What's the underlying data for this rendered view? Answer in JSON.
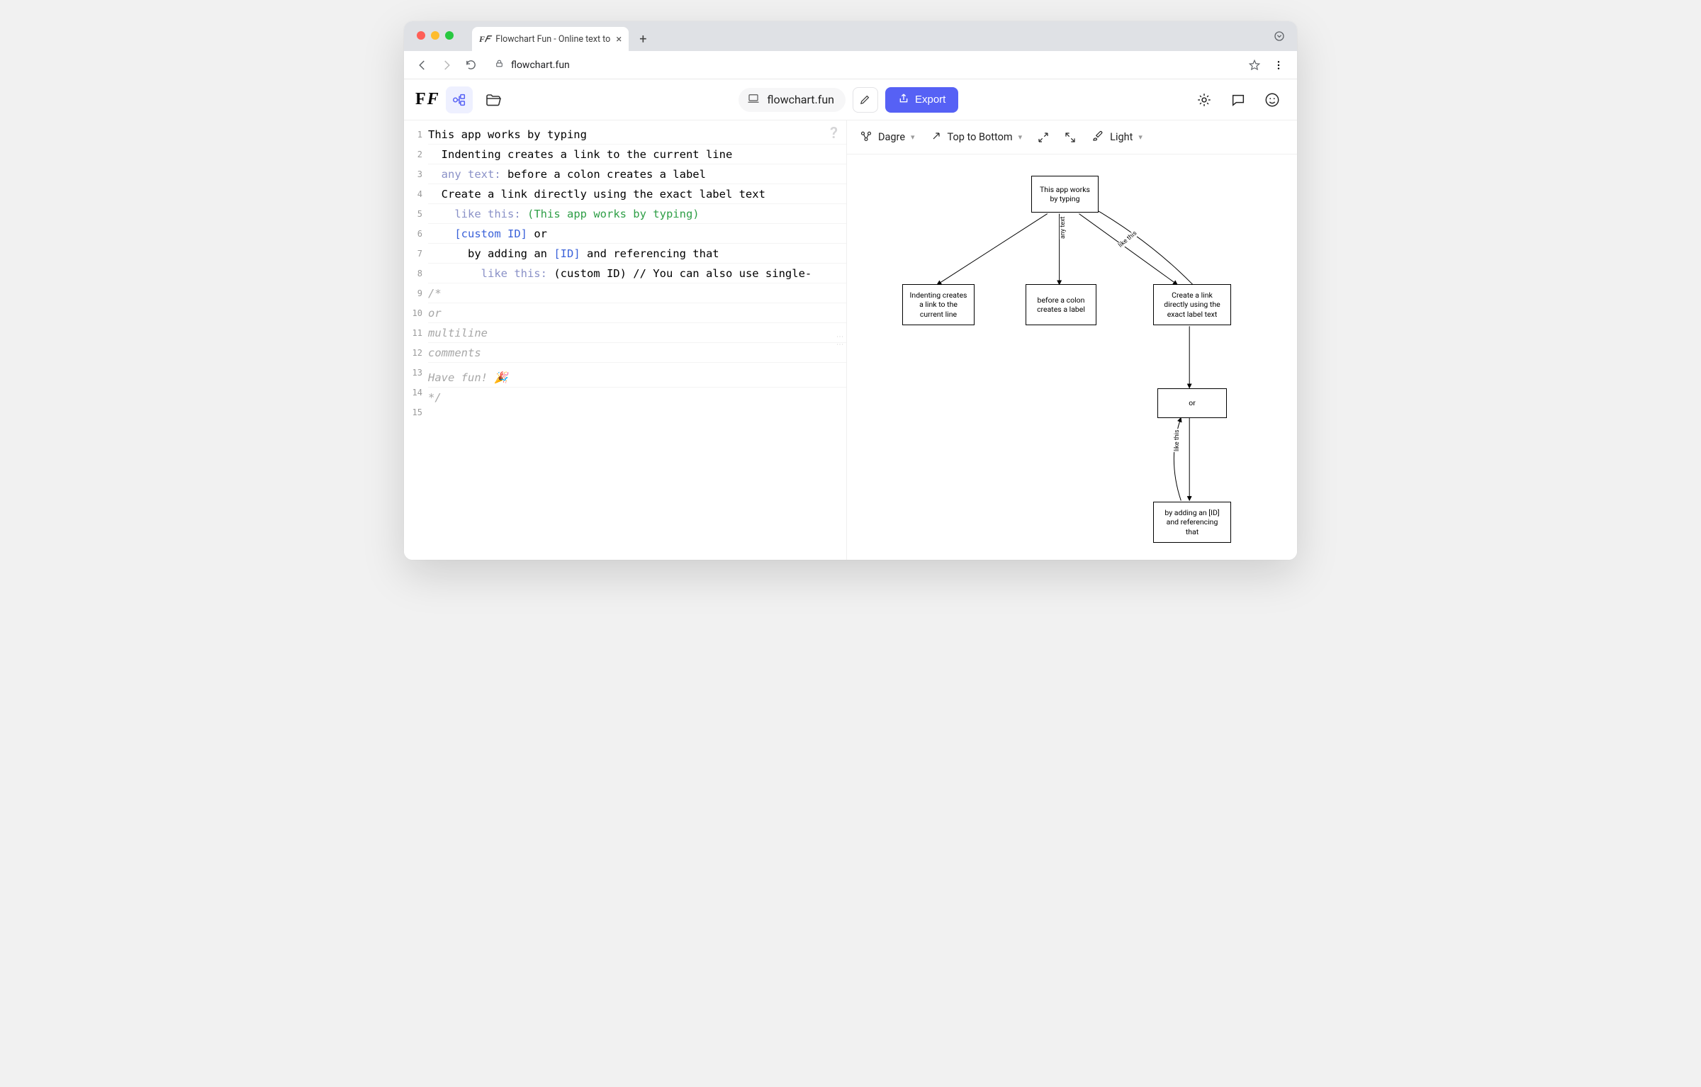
{
  "browser": {
    "tab_title": "Flowchart Fun - Online text to",
    "url": "flowchart.fun"
  },
  "header": {
    "doc_name": "flowchart.fun",
    "export_label": "Export"
  },
  "graph_toolbar": {
    "layout": "Dagre",
    "direction": "Top to Bottom",
    "theme": "Light"
  },
  "editor": {
    "lines": [
      {
        "n": 1,
        "indent": 0,
        "segs": [
          {
            "t": "This app works by typing"
          }
        ]
      },
      {
        "n": 2,
        "indent": 1,
        "segs": [
          {
            "t": "Indenting creates a link to the current line"
          }
        ]
      },
      {
        "n": 3,
        "indent": 1,
        "segs": [
          {
            "t": "any text:",
            "c": "tok-label"
          },
          {
            "t": " before a colon creates a label"
          }
        ]
      },
      {
        "n": 4,
        "indent": 1,
        "segs": [
          {
            "t": "Create a link directly using the exact label text"
          }
        ]
      },
      {
        "n": 5,
        "indent": 2,
        "segs": [
          {
            "t": "like this:",
            "c": "tok-label"
          },
          {
            "t": " "
          },
          {
            "t": "(This app works by typing)",
            "c": "tok-ref"
          }
        ]
      },
      {
        "n": 6,
        "indent": 2,
        "segs": [
          {
            "t": "[custom ID]",
            "c": "tok-id"
          },
          {
            "t": " or"
          }
        ]
      },
      {
        "n": 7,
        "indent": 3,
        "segs": [
          {
            "t": "by adding an "
          },
          {
            "t": "[ID]",
            "c": "tok-id"
          },
          {
            "t": " and referencing that"
          }
        ]
      },
      {
        "n": 8,
        "indent": 4,
        "segs": [
          {
            "t": "like this:",
            "c": "tok-label"
          },
          {
            "t": " (custom ID) // You can also use single-"
          }
        ]
      },
      {
        "n": 9,
        "indent": 0,
        "segs": [
          {
            "t": "/*",
            "c": "tok-comment"
          }
        ]
      },
      {
        "n": 10,
        "indent": 0,
        "segs": [
          {
            "t": "or",
            "c": "tok-comment"
          }
        ]
      },
      {
        "n": 11,
        "indent": 0,
        "segs": [
          {
            "t": "multiline",
            "c": "tok-comment"
          }
        ]
      },
      {
        "n": 12,
        "indent": 0,
        "segs": [
          {
            "t": "comments",
            "c": "tok-comment"
          }
        ]
      },
      {
        "n": 13,
        "indent": 0,
        "segs": [
          {
            "t": ""
          }
        ],
        "noborder": true
      },
      {
        "n": 14,
        "indent": 0,
        "segs": [
          {
            "t": "Have fun! 🎉",
            "c": "tok-comment"
          }
        ]
      },
      {
        "n": 15,
        "indent": 0,
        "segs": [
          {
            "t": "*/",
            "c": "tok-comment"
          }
        ],
        "noborder": true
      }
    ]
  },
  "graph": {
    "nodes": {
      "root": {
        "text": "This app works\nby typing"
      },
      "indent": {
        "text": "Indenting creates\na link to the\ncurrent line"
      },
      "colon": {
        "text": "before a colon\ncreates a label"
      },
      "direct": {
        "text": "Create a link\ndirectly using the\nexact label text"
      },
      "or": {
        "text": "or"
      },
      "byid": {
        "text": "by adding an [ID]\nand referencing\nthat"
      }
    },
    "edge_labels": {
      "any_text": "any text",
      "like_this_1": "like this",
      "like_this_2": "like this"
    }
  }
}
